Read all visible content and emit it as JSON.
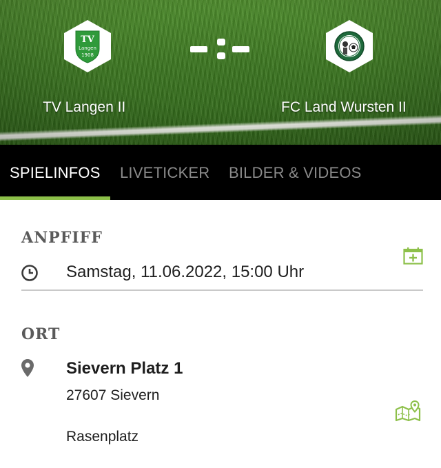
{
  "match": {
    "home_team": "TV Langen II",
    "away_team": "FC Land Wursten II",
    "score_display": "-:-",
    "home_logo_text": "TV",
    "home_logo_sub": "Langen",
    "home_logo_year": "1908"
  },
  "tabs": [
    {
      "label": "SPIELINFOS",
      "active": true
    },
    {
      "label": "LIVETICKER",
      "active": false
    },
    {
      "label": "BILDER & VIDEOS",
      "active": false
    }
  ],
  "kickoff": {
    "heading": "ANPFIFF",
    "datetime": "Samstag, 11.06.2022, 15:00 Uhr",
    "icon": "clock-icon",
    "action_icon": "calendar-add-icon"
  },
  "location": {
    "heading": "ORT",
    "name": "Sievern Platz 1",
    "address": "27607 Sievern",
    "surface": "Rasenplatz",
    "icon": "map-pin-icon",
    "action_icon": "map-route-icon"
  },
  "colors": {
    "accent": "#8dc04a",
    "tab_bar": "#000000",
    "heading": "#5a5a5a",
    "text": "#1e1e1e"
  }
}
